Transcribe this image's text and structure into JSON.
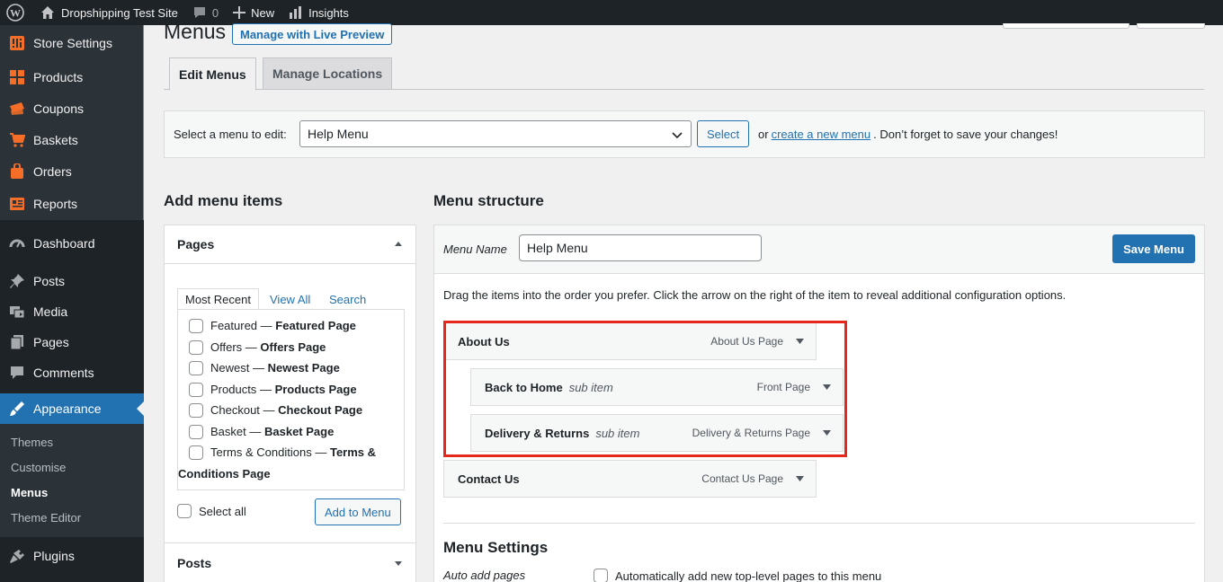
{
  "adminbar": {
    "site_name": "Dropshipping Test Site",
    "comments_count": "0",
    "new_label": "New",
    "insights_label": "Insights"
  },
  "sidebar": {
    "store_items": [
      {
        "label": "Store Settings",
        "icon": "store-settings-icon"
      },
      {
        "label": "Products",
        "icon": "products-grid-icon"
      },
      {
        "label": "Coupons",
        "icon": "coupons-icon"
      },
      {
        "label": "Baskets",
        "icon": "cart-icon"
      },
      {
        "label": "Orders",
        "icon": "bag-icon"
      },
      {
        "label": "Reports",
        "icon": "reports-icon"
      }
    ],
    "items": [
      {
        "label": "Dashboard",
        "icon": "dashboard-icon"
      },
      {
        "label": "Posts",
        "icon": "pin-icon"
      },
      {
        "label": "Media",
        "icon": "media-icon"
      },
      {
        "label": "Pages",
        "icon": "pages-icon"
      },
      {
        "label": "Comments",
        "icon": "comment-icon"
      },
      {
        "label": "Appearance",
        "icon": "brush-icon"
      }
    ],
    "submenu": [
      "Themes",
      "Customise",
      "Menus",
      "Theme Editor"
    ],
    "plugins_label": "Plugins"
  },
  "page": {
    "title": "Menus",
    "live_preview": "Manage with Live Preview"
  },
  "tabs": [
    "Edit Menus",
    "Manage Locations"
  ],
  "select_bar": {
    "label": "Select a menu to edit:",
    "selected": "Help Menu",
    "button": "Select",
    "or": "or",
    "link": "create a new menu",
    "tail": ". Don’t forget to save your changes!"
  },
  "add_items": {
    "heading": "Add menu items",
    "pages_title": "Pages",
    "tabs": [
      "Most Recent",
      "View All",
      "Search"
    ],
    "pages": [
      {
        "name": "Featured",
        "bold": "Featured Page"
      },
      {
        "name": "Offers",
        "bold": "Offers Page"
      },
      {
        "name": "Newest",
        "bold": "Newest Page"
      },
      {
        "name": "Products",
        "bold": "Products Page"
      },
      {
        "name": "Checkout",
        "bold": "Checkout Page"
      },
      {
        "name": "Basket",
        "bold": "Basket Page"
      },
      {
        "name": "Terms & Conditions",
        "bold_a": "Terms &",
        "bold_b": "Conditions Page"
      }
    ],
    "dash": "—",
    "select_all": "Select all",
    "add_button": "Add to Menu",
    "posts_title": "Posts"
  },
  "structure": {
    "heading": "Menu structure",
    "menu_name_label": "Menu Name",
    "menu_name_value": "Help Menu",
    "save_button": "Save Menu",
    "instructions": "Drag the items into the order you prefer. Click the arrow on the right of the item to reveal additional configuration options.",
    "items": [
      {
        "title": "About Us",
        "sub": "",
        "type": "About Us Page"
      },
      {
        "title": "Back to Home",
        "sub": "sub item",
        "type": "Front Page"
      },
      {
        "title": "Delivery & Returns",
        "sub": "sub item",
        "type": "Delivery & Returns Page"
      },
      {
        "title": "Contact Us",
        "sub": "",
        "type": "Contact Us Page"
      }
    ],
    "highlight_color": "#e6271c",
    "settings_title": "Menu Settings",
    "auto_add_label": "Auto add pages",
    "auto_add_text": "Automatically add new top-level pages to this menu"
  },
  "colors": {
    "primary": "#2271b1",
    "adminbar": "#1d2327",
    "store_accent": "#f56e28"
  }
}
